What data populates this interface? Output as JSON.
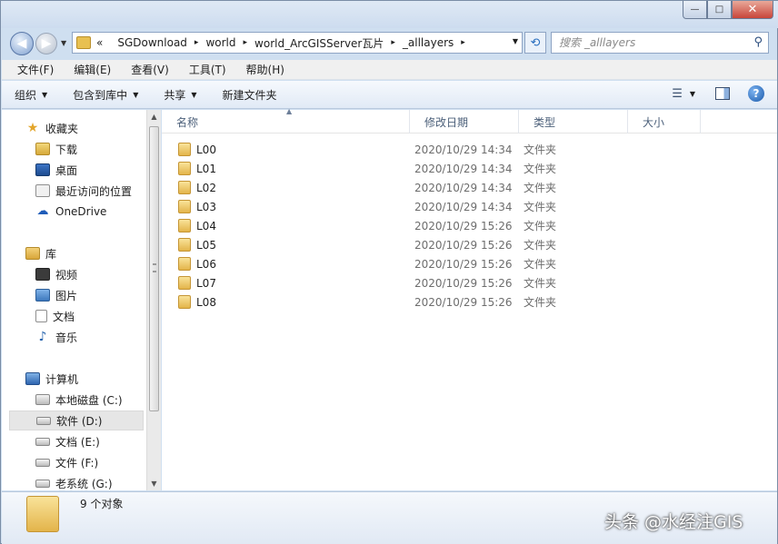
{
  "window": {
    "buttons": {
      "minimize": "—",
      "maximize": "□",
      "close": "✕"
    }
  },
  "address": {
    "overflow": "«",
    "crumbs": [
      "SGDownload",
      "world",
      "world_ArcGISServer瓦片",
      "_alllayers"
    ],
    "separator": "▸",
    "search_placeholder": "搜索 _alllayers"
  },
  "menubar": [
    "文件(F)",
    "编辑(E)",
    "查看(V)",
    "工具(T)",
    "帮助(H)"
  ],
  "commandbar": [
    "组织",
    "包含到库中",
    "共享",
    "新建文件夹"
  ],
  "navpane": {
    "favorites": {
      "title": "收藏夹",
      "items": [
        "下载",
        "桌面",
        "最近访问的位置",
        "OneDrive"
      ]
    },
    "libraries": {
      "title": "库",
      "items": [
        "视频",
        "图片",
        "文档",
        "音乐"
      ]
    },
    "computer": {
      "title": "计算机",
      "items": [
        "本地磁盘 (C:)",
        "软件 (D:)",
        "文档 (E:)",
        "文件 (F:)",
        "老系统 (G:)"
      ]
    },
    "selected": "软件 (D:)"
  },
  "columns": [
    "名称",
    "修改日期",
    "类型",
    "大小"
  ],
  "files": [
    {
      "name": "L00",
      "date": "2020/10/29 14:34",
      "type": "文件夹"
    },
    {
      "name": "L01",
      "date": "2020/10/29 14:34",
      "type": "文件夹"
    },
    {
      "name": "L02",
      "date": "2020/10/29 14:34",
      "type": "文件夹"
    },
    {
      "name": "L03",
      "date": "2020/10/29 14:34",
      "type": "文件夹"
    },
    {
      "name": "L04",
      "date": "2020/10/29 15:26",
      "type": "文件夹"
    },
    {
      "name": "L05",
      "date": "2020/10/29 15:26",
      "type": "文件夹"
    },
    {
      "name": "L06",
      "date": "2020/10/29 15:26",
      "type": "文件夹"
    },
    {
      "name": "L07",
      "date": "2020/10/29 15:26",
      "type": "文件夹"
    },
    {
      "name": "L08",
      "date": "2020/10/29 15:26",
      "type": "文件夹"
    }
  ],
  "status": {
    "count": "9 个对象"
  },
  "watermark": "头条 @水经注GIS",
  "colors": {
    "window_frame": "#cfdff0",
    "folder": "#e3b44a",
    "accent": "#2a6fbf"
  }
}
